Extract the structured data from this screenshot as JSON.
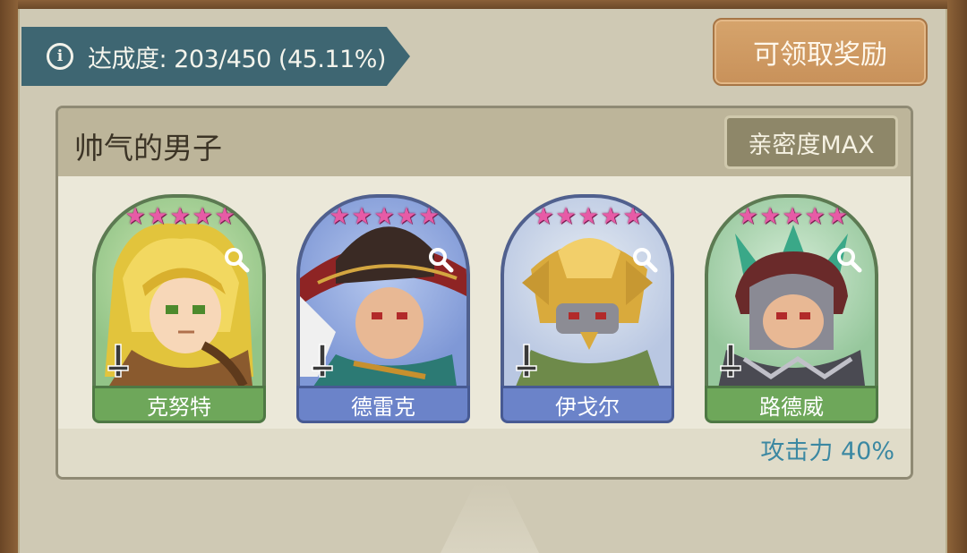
{
  "progress": {
    "label": "达成度: 203/450 (45.11%)",
    "current": 203,
    "total": 450,
    "percent": 45.11
  },
  "claim_button_label": "可领取奖励",
  "collection": {
    "title": "帅气的男子",
    "affinity_label": "亲密度MAX",
    "bonus_label": "攻击力 40%",
    "heroes": [
      {
        "name": "克努特",
        "stars": 5,
        "class_icon": "sword-icon",
        "theme": "green"
      },
      {
        "name": "德雷克",
        "stars": 5,
        "class_icon": "sword-icon",
        "theme": "blue"
      },
      {
        "name": "伊戈尔",
        "stars": 5,
        "class_icon": "sword-icon",
        "theme": "blue"
      },
      {
        "name": "路德威",
        "stars": 5,
        "class_icon": "sword-icon",
        "theme": "green"
      }
    ]
  },
  "colors": {
    "banner": "#3e6672",
    "claim_button": "#d6a46c",
    "star": "#e75ba6",
    "bonus_text": "#3b88a2"
  }
}
